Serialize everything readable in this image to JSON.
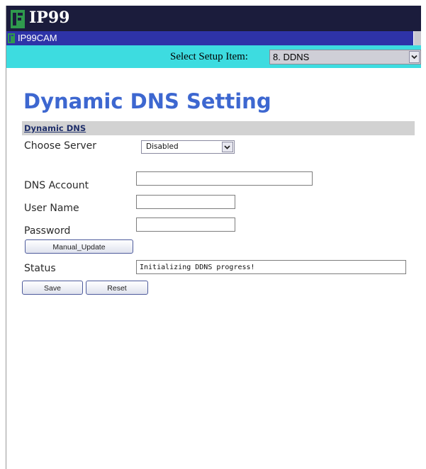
{
  "brand": {
    "logo_text": "IP99",
    "device_name": "IP99CAM"
  },
  "setup": {
    "label": "Select Setup Item:",
    "selected": "8. DDNS"
  },
  "page": {
    "title": "Dynamic DNS Setting",
    "section": "Dynamic DNS"
  },
  "form": {
    "server": {
      "label": "Choose Server",
      "selected": "Disabled"
    },
    "dns_account": {
      "label": "DNS Account",
      "value": ""
    },
    "user_name": {
      "label": "User Name",
      "value": ""
    },
    "password": {
      "label": "Password",
      "value": ""
    },
    "manual_update_label": "Manual_Update",
    "status": {
      "label": "Status",
      "value": "Initializing DDNS progress!"
    },
    "save_label": "Save",
    "reset_label": "Reset"
  },
  "colors": {
    "logo_bar": "#1b1c3c",
    "device_bar": "#2e33a8",
    "setup_bar": "#3ddce0",
    "title": "#3d67d0",
    "section_bg": "#d2d2d2"
  },
  "icons": {
    "logo": "ip99-logo-icon",
    "device": "camera-logo-icon",
    "dropdown": "chevron-down-icon"
  }
}
